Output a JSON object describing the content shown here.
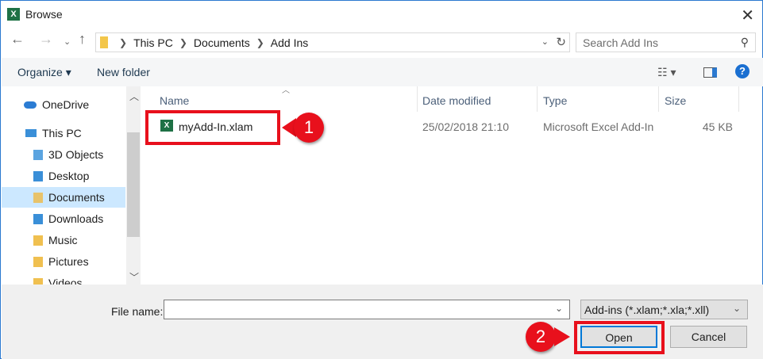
{
  "window": {
    "title": "Browse",
    "app_icon": "excel-icon"
  },
  "address": {
    "crumbs": [
      "This PC",
      "Documents",
      "Add Ins"
    ]
  },
  "search": {
    "placeholder": "Search Add Ins"
  },
  "toolbar": {
    "organize": "Organize ▾",
    "new_folder": "New folder"
  },
  "sidebar": {
    "items": [
      {
        "label": "OneDrive",
        "color": "#2b7cd3"
      },
      {
        "label": "This PC",
        "color": "#3a8fd8"
      },
      {
        "label": "3D Objects",
        "color": "#5ba4e0"
      },
      {
        "label": "Desktop",
        "color": "#3a8fd8"
      },
      {
        "label": "Documents",
        "color": "#e8c36a",
        "selected": true
      },
      {
        "label": "Downloads",
        "color": "#3a8fd8"
      },
      {
        "label": "Music",
        "color": "#f0c050"
      },
      {
        "label": "Pictures",
        "color": "#f0c050"
      },
      {
        "label": "Videos",
        "color": "#f0c050"
      }
    ]
  },
  "columns": [
    "Name",
    "Date modified",
    "Type",
    "Size"
  ],
  "files": [
    {
      "name": "myAdd-In.xlam",
      "date": "25/02/2018 21:10",
      "type": "Microsoft Excel Add-In",
      "size": "45 KB"
    }
  ],
  "annotations": [
    "1",
    "2"
  ],
  "bottom": {
    "file_name_label": "File name:",
    "file_name_value": "",
    "file_type": "Add-ins (*.xlam;*.xla;*.xll)",
    "open": "Open",
    "cancel": "Cancel"
  },
  "colors": {
    "highlight": "#e8101c",
    "accent": "#0078d7"
  }
}
